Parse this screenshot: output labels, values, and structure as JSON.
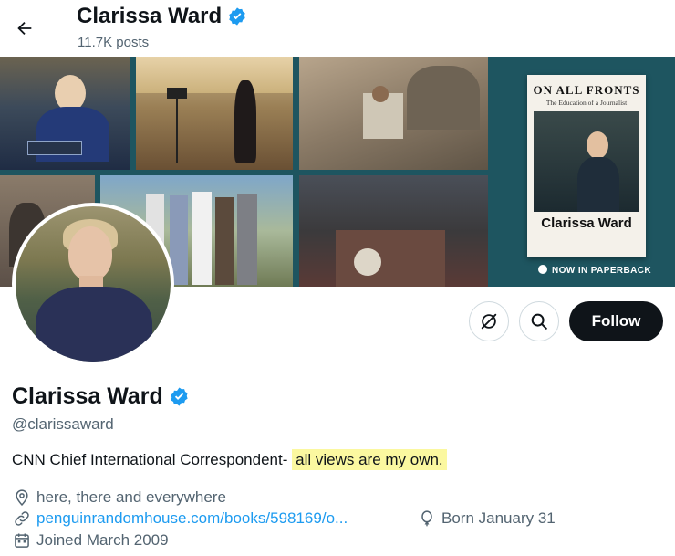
{
  "header": {
    "name": "Clarissa Ward",
    "posts": "11.7K posts"
  },
  "banner": {
    "book_title": "ON ALL FRONTS",
    "book_subtitle": "The Education of a Journalist",
    "book_author": "Clarissa Ward",
    "paperback_text": "NOW IN PAPERBACK"
  },
  "actions": {
    "follow_label": "Follow"
  },
  "profile": {
    "name": "Clarissa Ward",
    "handle": "@clarissaward",
    "bio_plain": "CNN Chief International Correspondent- ",
    "bio_highlight": "all views are my own.",
    "location": "here, there and everywhere",
    "website": "penguinrandomhouse.com/books/598169/o...",
    "birthday": "Born January 31",
    "joined": "Joined March 2009"
  },
  "colors": {
    "verified": "#1d9bf0",
    "link": "#1d9bf0",
    "follow_bg": "#0f1419",
    "highlight": "#fbf8a0"
  }
}
